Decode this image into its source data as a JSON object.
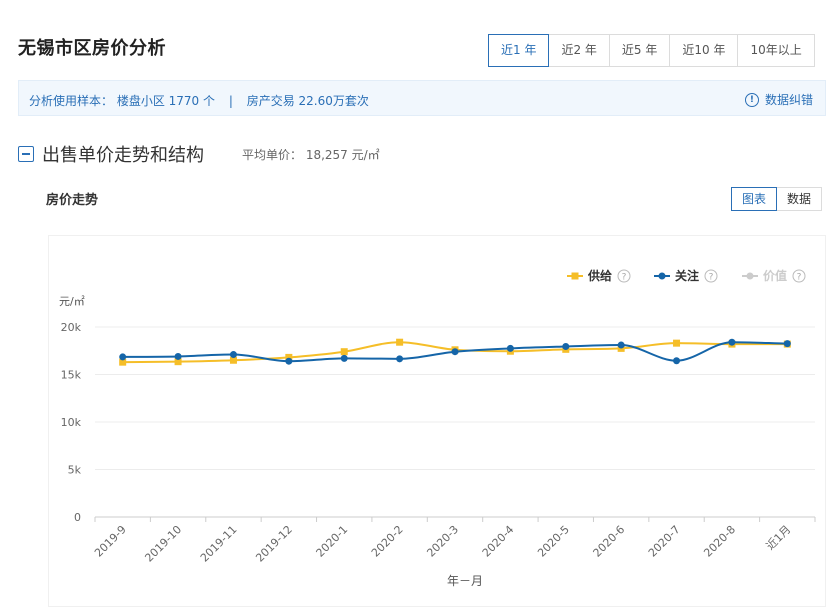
{
  "header": {
    "title": "无锡市区房价分析",
    "range_tabs": [
      {
        "label": "近1 年",
        "active": true
      },
      {
        "label": "近2 年",
        "active": false
      },
      {
        "label": "近5 年",
        "active": false
      },
      {
        "label": "近10 年",
        "active": false
      },
      {
        "label": "10年以上",
        "active": false
      }
    ]
  },
  "info_bar": {
    "sample_text": "分析使用样本： 楼盘小区 1770 个",
    "separator": "|",
    "trade_text": "房产交易 22.60万套次",
    "correction_icon": "info-circle-icon",
    "correction_label": "数据纠错"
  },
  "section": {
    "collapse_icon": "minus-square-icon",
    "title": "出售单价走势和结构",
    "avg_price": "平均单价： 18,257 元/㎡"
  },
  "subsection": {
    "title": "房价走势",
    "view_buttons": [
      {
        "label": "图表",
        "active": true
      },
      {
        "label": "数据",
        "active": false
      }
    ]
  },
  "chart_data": {
    "type": "line",
    "title": "",
    "xlabel": "年－月",
    "ylabel": "元/㎡",
    "categories": [
      "2019-9",
      "2019-10",
      "2019-11",
      "2019-12",
      "2020-1",
      "2020-2",
      "2020-3",
      "2020-4",
      "2020-5",
      "2020-6",
      "2020-7",
      "2020-8",
      "近1月"
    ],
    "ylim": [
      0,
      20000
    ],
    "yticks": [
      {
        "value": 0,
        "label": "0"
      },
      {
        "value": 5000,
        "label": "5k"
      },
      {
        "value": 10000,
        "label": "10k"
      },
      {
        "value": 15000,
        "label": "15k"
      },
      {
        "value": 20000,
        "label": "20k"
      }
    ],
    "grid": true,
    "legend_position": "top-right",
    "series": [
      {
        "name": "供给",
        "color": "#f5be28",
        "marker": "square",
        "enabled": true,
        "values": [
          16300,
          16350,
          16500,
          16800,
          17400,
          18400,
          17600,
          17450,
          17650,
          17750,
          18300,
          18200,
          18200
        ]
      },
      {
        "name": "关注",
        "color": "#1565a8",
        "marker": "circle",
        "enabled": true,
        "values": [
          16850,
          16900,
          17100,
          16400,
          16700,
          16650,
          17400,
          17750,
          17950,
          18100,
          16450,
          18400,
          18250
        ]
      },
      {
        "name": "价值",
        "color": "#cccccc",
        "marker": "circle",
        "enabled": false,
        "values": []
      }
    ],
    "legend_help_icon": "question-circle-icon"
  }
}
